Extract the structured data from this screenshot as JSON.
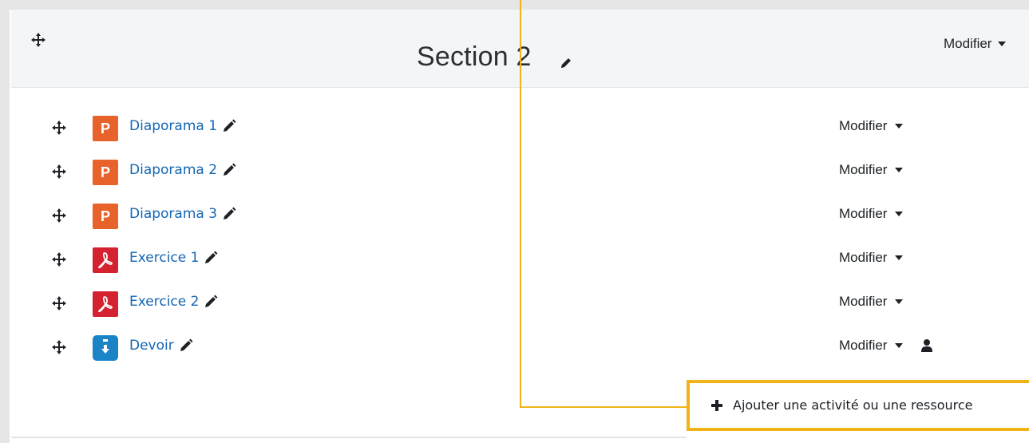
{
  "section": {
    "title": "Section 2",
    "modifier_label": "Modifier"
  },
  "activities": [
    {
      "name": "Diaporama 1",
      "type": "powerpoint",
      "icon_letter": "P",
      "modifier_label": "Modifier",
      "has_user_icon": false
    },
    {
      "name": "Diaporama 2",
      "type": "powerpoint",
      "icon_letter": "P",
      "modifier_label": "Modifier",
      "has_user_icon": false
    },
    {
      "name": "Diaporama 3",
      "type": "powerpoint",
      "icon_letter": "P",
      "modifier_label": "Modifier",
      "has_user_icon": false
    },
    {
      "name": "Exercice 1",
      "type": "pdf",
      "modifier_label": "Modifier",
      "has_user_icon": false
    },
    {
      "name": "Exercice 2",
      "type": "pdf",
      "modifier_label": "Modifier",
      "has_user_icon": false
    },
    {
      "name": "Devoir",
      "type": "assignment",
      "modifier_label": "Modifier",
      "has_user_icon": true
    }
  ],
  "add_activity": {
    "label": "Ajouter une activité ou une ressource"
  },
  "colors": {
    "link": "#1566b3",
    "powerpoint": "#e8632c",
    "pdf": "#d42230",
    "assignment": "#1a84c7",
    "highlight": "#f0b418"
  },
  "icons": {
    "move": "move-icon",
    "edit": "pencil-icon",
    "caret": "caret-down-icon",
    "user": "user-icon",
    "plus": "plus-icon"
  }
}
